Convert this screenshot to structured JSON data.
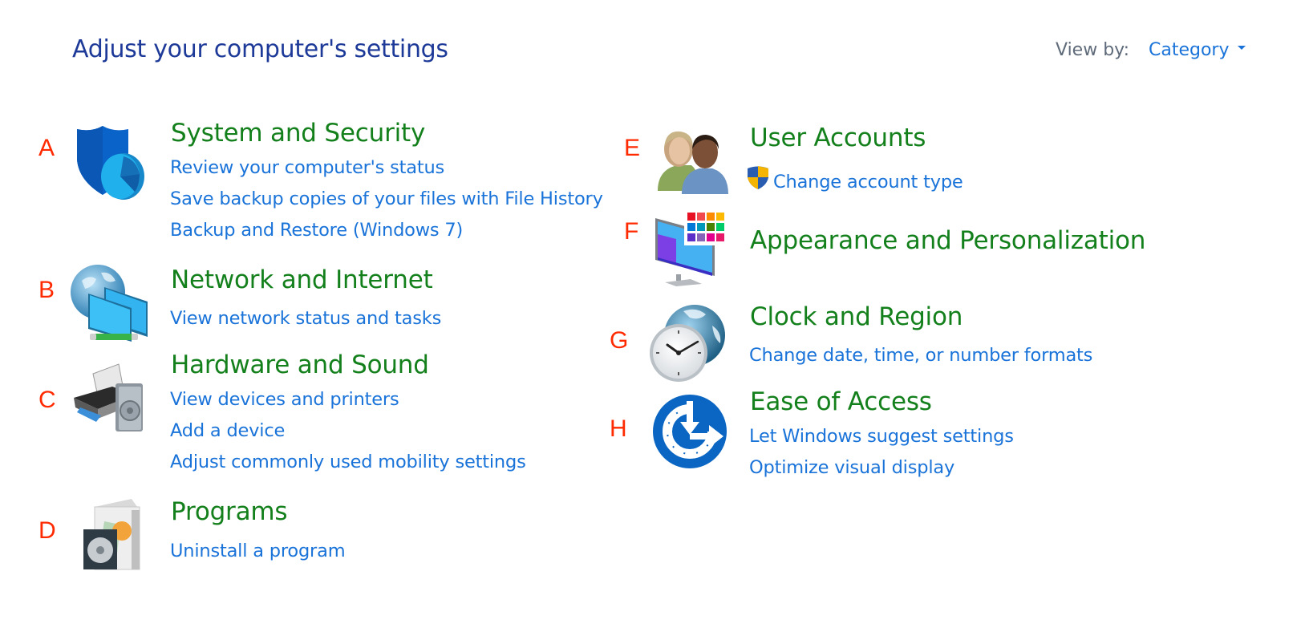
{
  "header": {
    "title": "Adjust your computer's settings",
    "view_by_label": "View by:",
    "view_by_value": "Category"
  },
  "markers": [
    "A",
    "B",
    "C",
    "D",
    "E",
    "F",
    "G",
    "H"
  ],
  "categories": [
    {
      "marker": "A",
      "icon": "shield-pie-icon",
      "title": "System and Security",
      "links": [
        "Review your computer's status",
        "Save backup copies of your files with File History",
        "Backup and Restore (Windows 7)"
      ]
    },
    {
      "marker": "B",
      "icon": "network-globe-icon",
      "title": "Network and Internet",
      "links": [
        "View network status and tasks"
      ]
    },
    {
      "marker": "C",
      "icon": "printer-speaker-icon",
      "title": "Hardware and Sound",
      "links": [
        "View devices and printers",
        "Add a device",
        "Adjust commonly used mobility settings"
      ]
    },
    {
      "marker": "D",
      "icon": "program-box-icon",
      "title": "Programs",
      "links": [
        "Uninstall a program"
      ]
    },
    {
      "marker": "E",
      "icon": "users-icon",
      "title": "User Accounts",
      "links": [
        "Change account type"
      ],
      "link_icon": "uac-shield-icon"
    },
    {
      "marker": "F",
      "icon": "monitor-palette-icon",
      "title": "Appearance and Personalization",
      "links": []
    },
    {
      "marker": "G",
      "icon": "clock-globe-icon",
      "title": "Clock and Region",
      "links": [
        "Change date, time, or number formats"
      ]
    },
    {
      "marker": "H",
      "icon": "ease-of-access-icon",
      "title": "Ease of Access",
      "links": [
        "Let Windows suggest settings",
        "Optimize visual display"
      ]
    }
  ],
  "colors": {
    "title": "#1e3a99",
    "category_title": "#13801c",
    "link": "#1a73d9",
    "marker": "#ff2a00"
  }
}
